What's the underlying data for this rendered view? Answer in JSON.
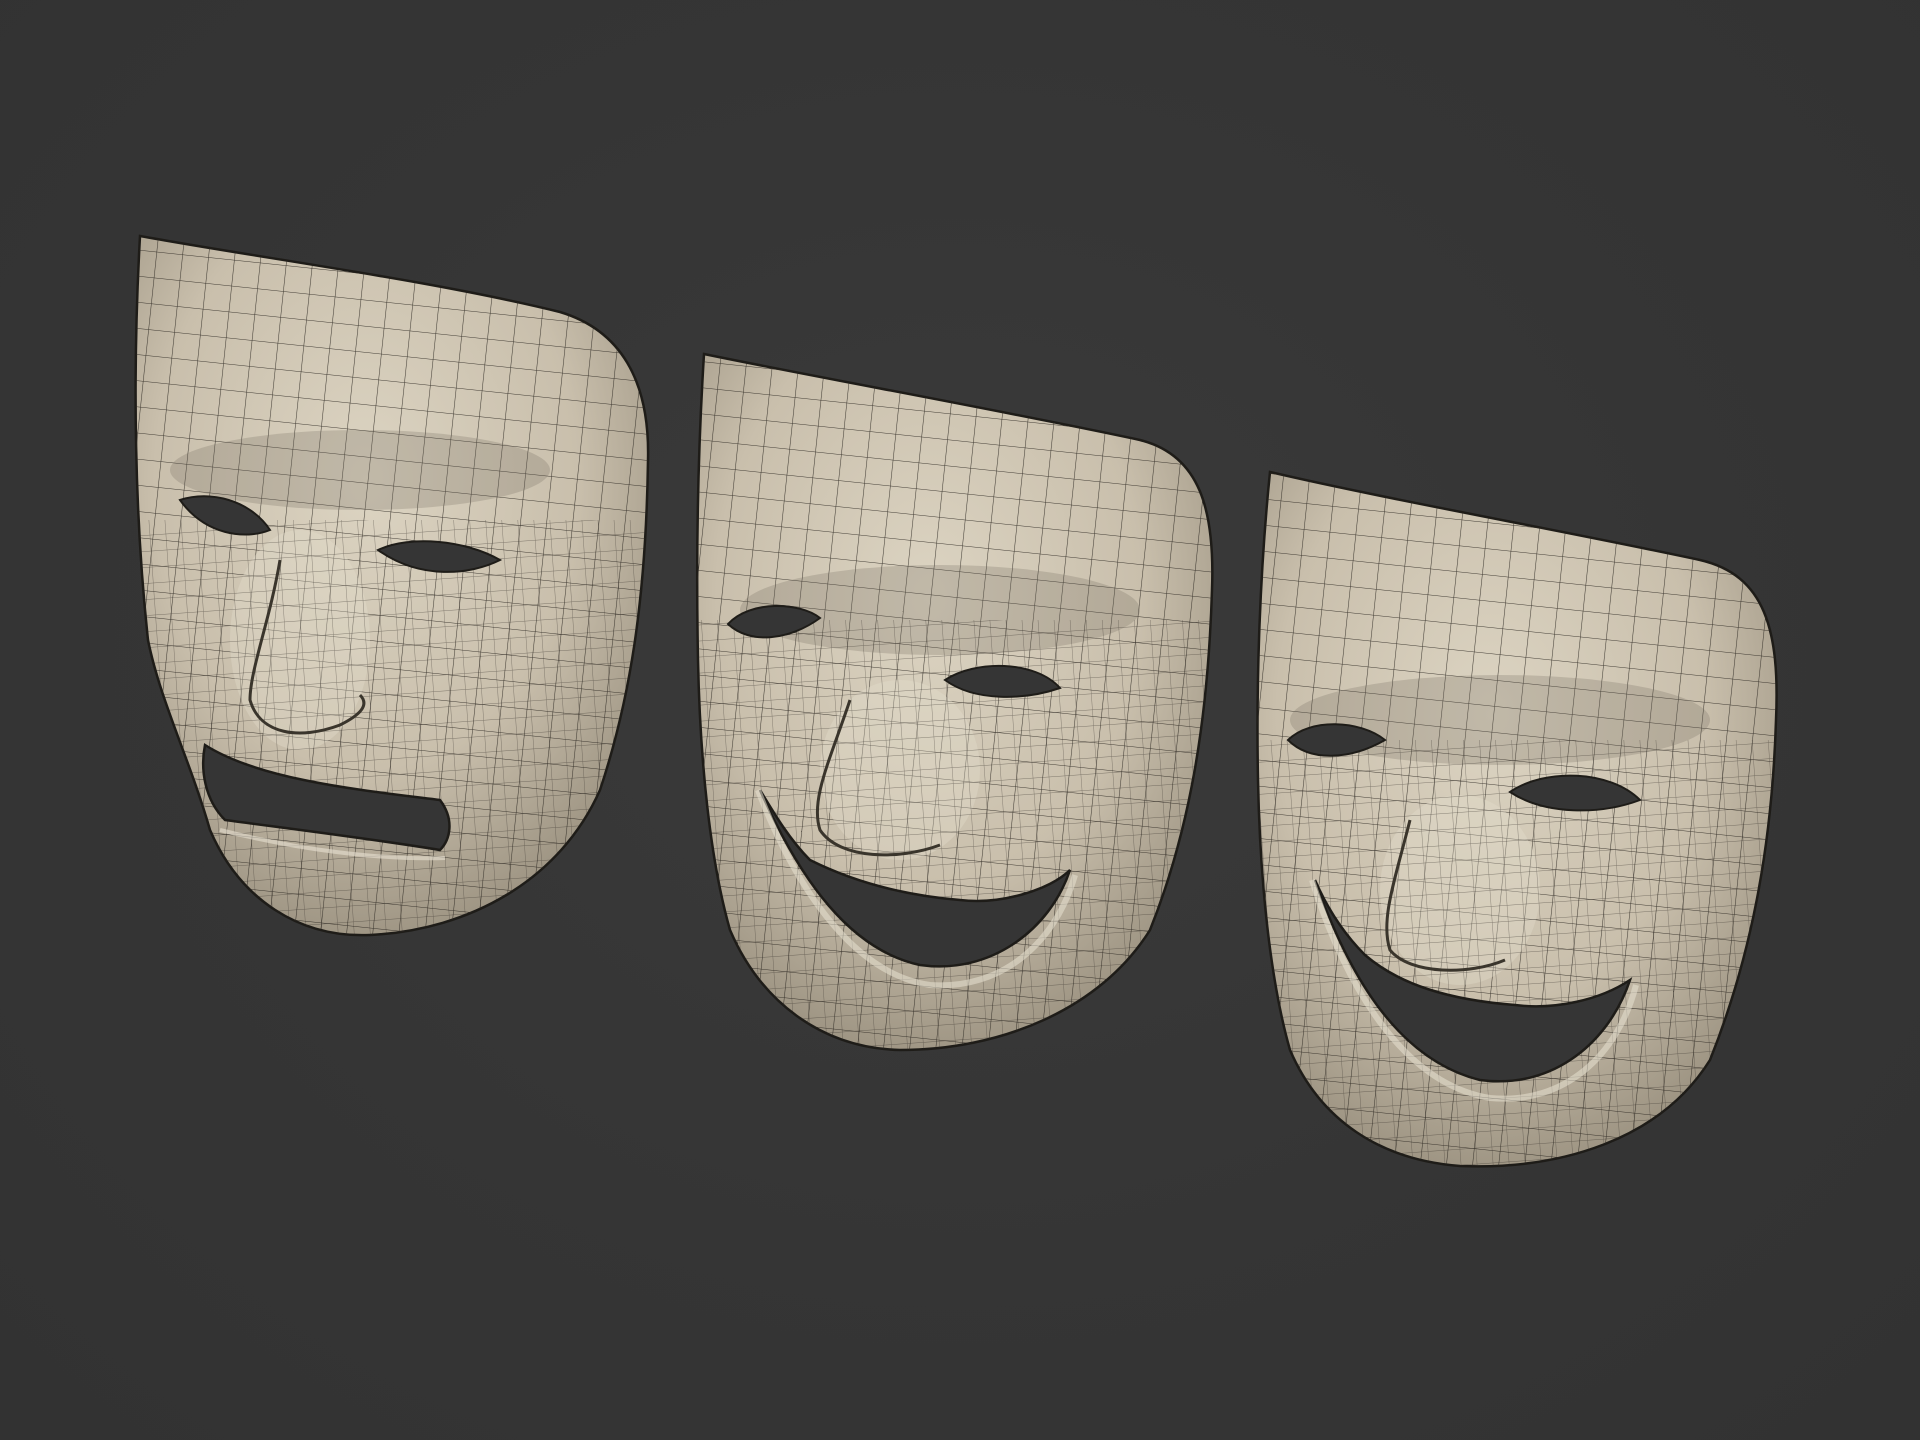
{
  "scene": {
    "background_color": "#353535",
    "mesh_color": "#cfc6b4",
    "wire_color": "#2a2620",
    "cavity_color": "#353535",
    "masks": [
      {
        "name": "tragedy-mask",
        "expression": "sad"
      },
      {
        "name": "comedy-mask",
        "expression": "smiling"
      },
      {
        "name": "comedy-mask-grin",
        "expression": "grinning"
      }
    ]
  }
}
